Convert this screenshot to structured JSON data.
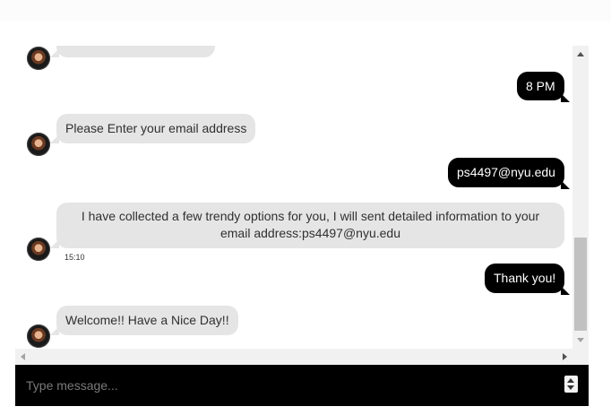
{
  "messages": [
    {
      "sender": "bot",
      "text": ""
    },
    {
      "sender": "user",
      "text": "8 PM"
    },
    {
      "sender": "bot",
      "text": "Please Enter your email address"
    },
    {
      "sender": "user",
      "text": "ps4497@nyu.edu"
    },
    {
      "sender": "bot",
      "text": "I have collected a few trendy options for you, I will sent detailed information to your email address:ps4497@nyu.edu",
      "time": "15:10"
    },
    {
      "sender": "user",
      "text": "Thank you!"
    },
    {
      "sender": "bot",
      "text": "Welcome!! Have a Nice Day!!"
    }
  ],
  "composer": {
    "placeholder": "Type message...",
    "value": ""
  },
  "colors": {
    "bot_bubble": "#e5e5e5",
    "user_bubble": "#000000",
    "input_bar": "#000000"
  },
  "icons": {
    "avatar": "bot-avatar",
    "scroll_up": "chevron-up-icon",
    "scroll_down": "chevron-down-icon",
    "scroll_left": "chevron-left-icon",
    "scroll_right": "chevron-right-icon"
  }
}
